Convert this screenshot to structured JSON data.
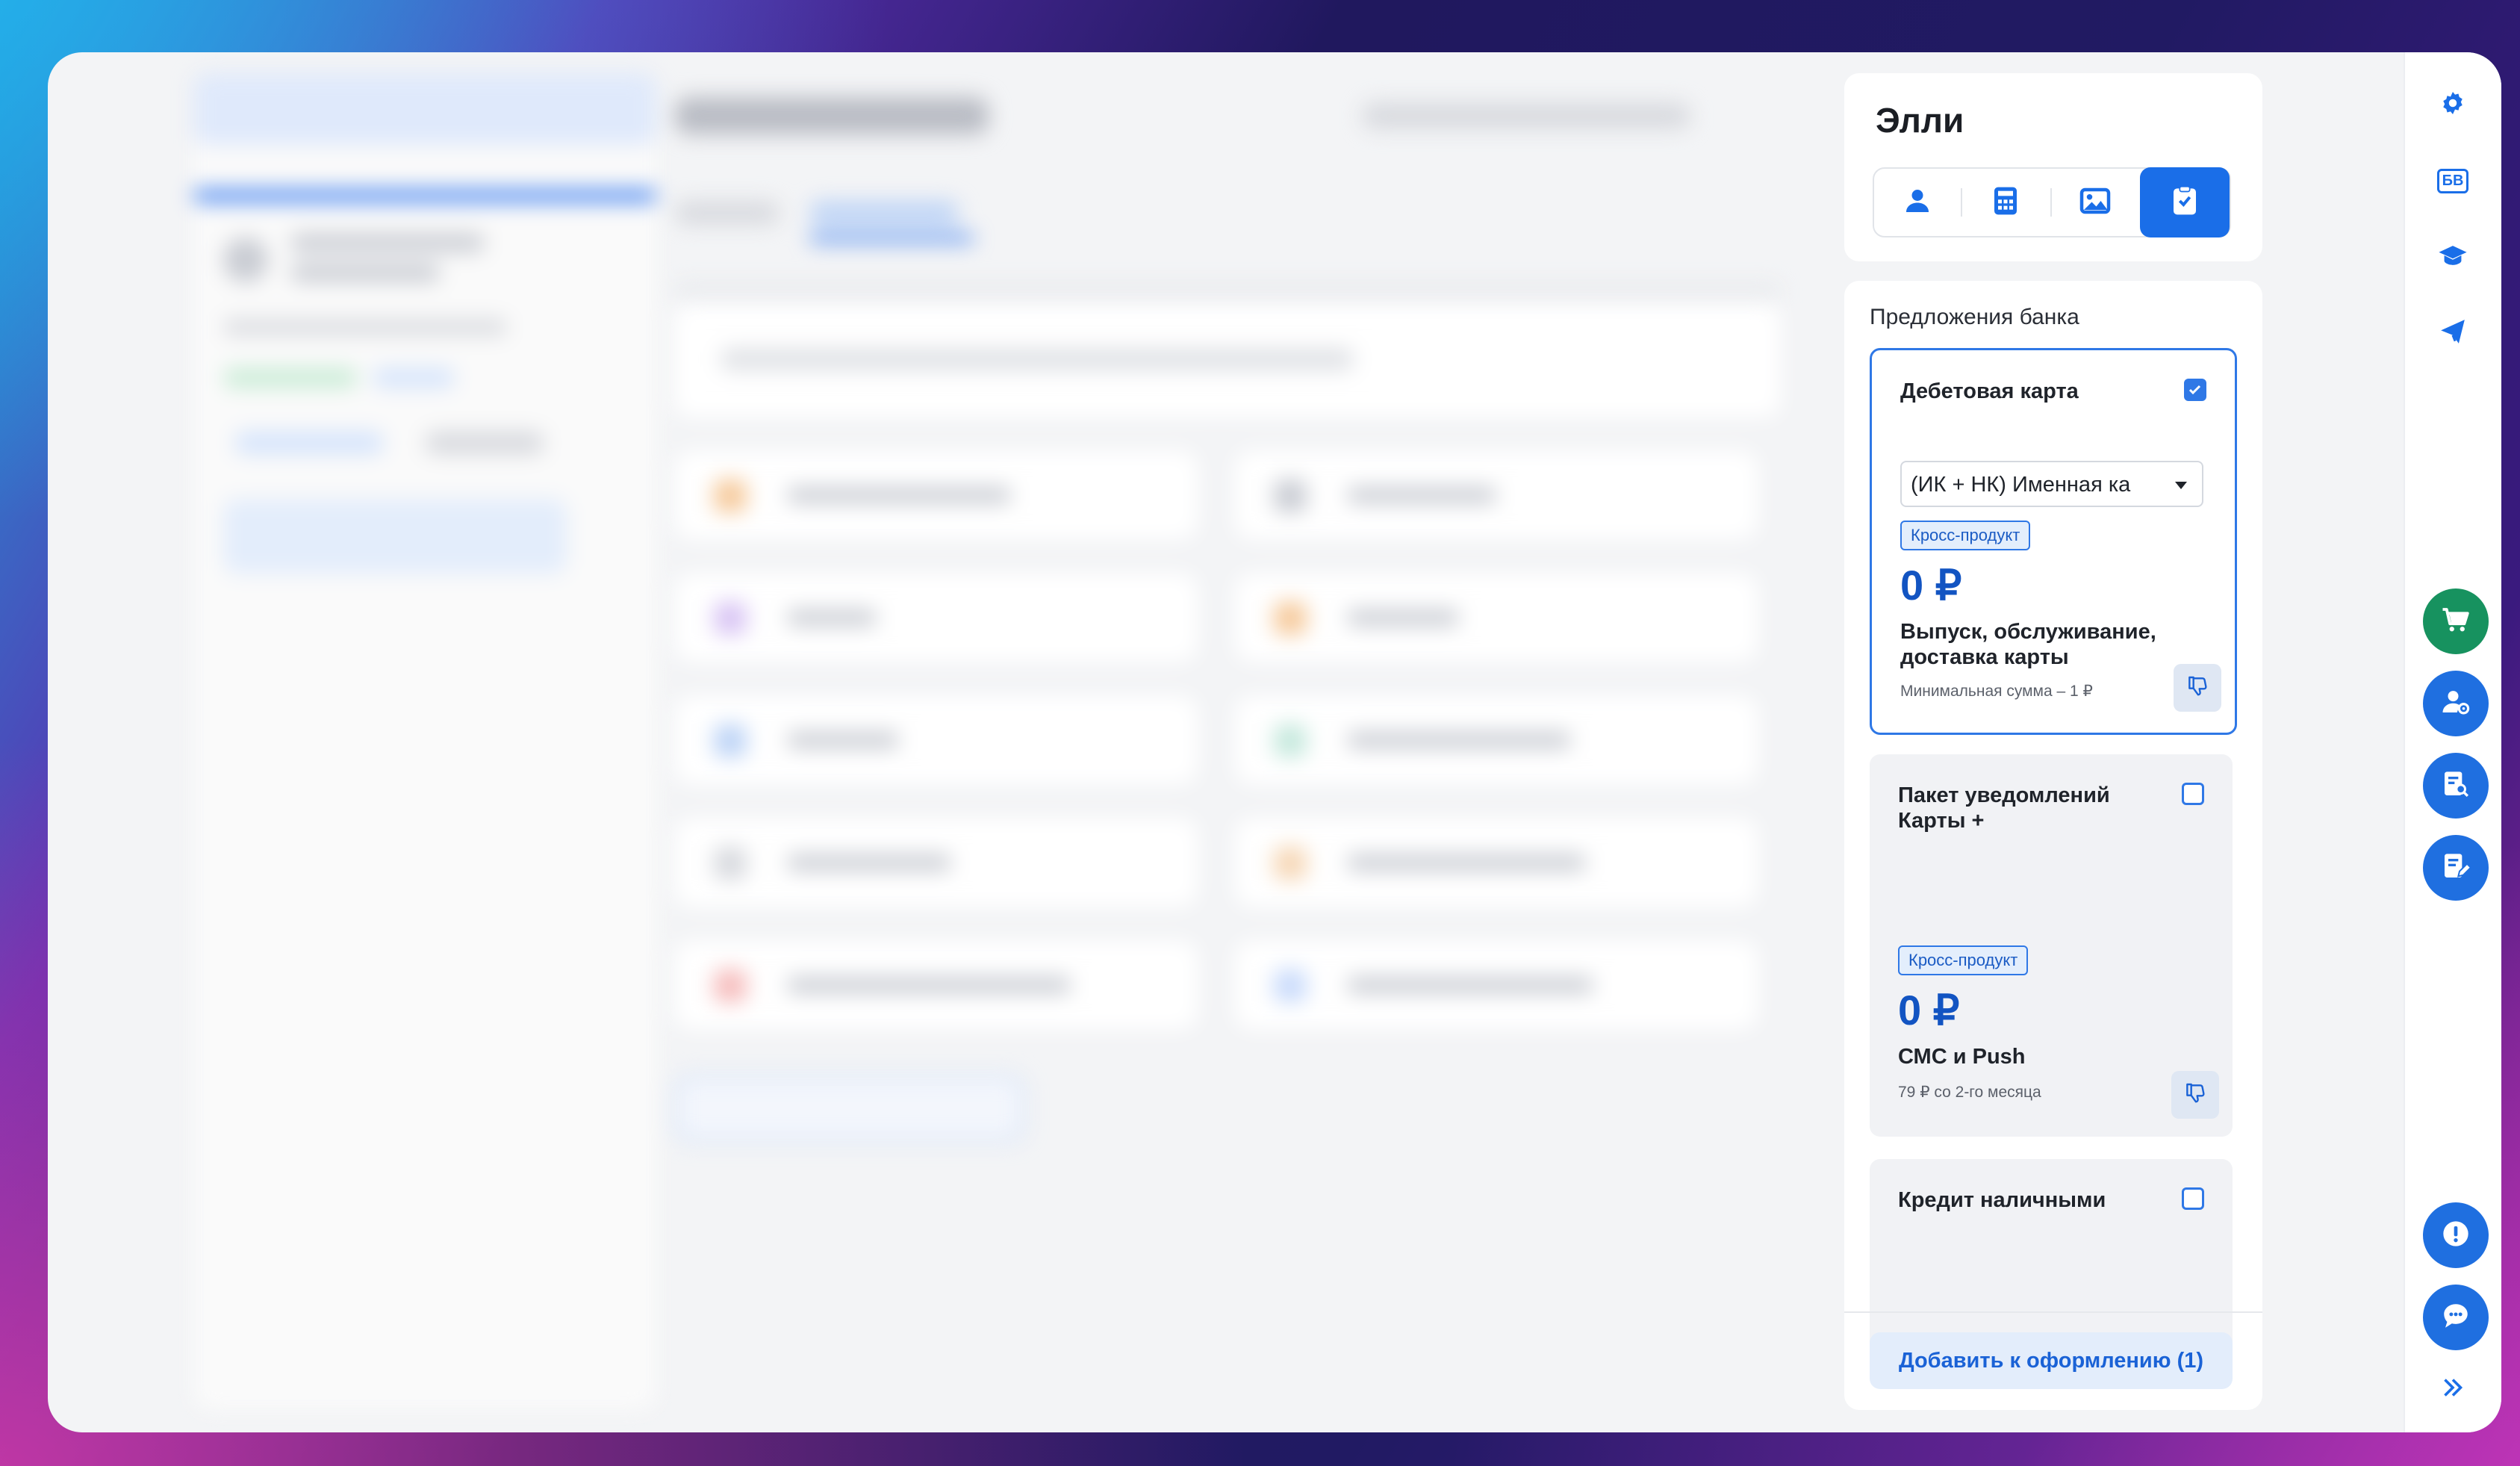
{
  "assistant": {
    "title": "Элли",
    "tabs": [
      {
        "icon": "user-icon",
        "active": false
      },
      {
        "icon": "calculator-icon",
        "active": false
      },
      {
        "icon": "image-icon",
        "active": false
      },
      {
        "icon": "clipboard-check-icon",
        "active": true
      }
    ],
    "section_title": "Предложения банка",
    "offers": [
      {
        "name": "Дебетовая карта",
        "checked": true,
        "dropdown_value": "(ИК + НК) Именная ка",
        "tag": "Кросс-продукт",
        "price": "0 ₽",
        "description": "Выпуск, обслуживание, доставка карты",
        "note": "Минимальная сумма – 1 ₽"
      },
      {
        "name": "Пакет уведомлений Карты +",
        "checked": false,
        "tag": "Кросс-продукт",
        "price": "0 ₽",
        "description": "СМС и Push",
        "note": "79 ₽ со 2-го месяца"
      },
      {
        "name": "Кредит наличными",
        "checked": false
      }
    ],
    "add_button": "Добавить к оформлению (1)"
  },
  "rail": {
    "badge": "БВ",
    "colors": {
      "accent": "#1a6ee8",
      "cart": "#17925f",
      "blue": "#1f6fe0"
    }
  }
}
